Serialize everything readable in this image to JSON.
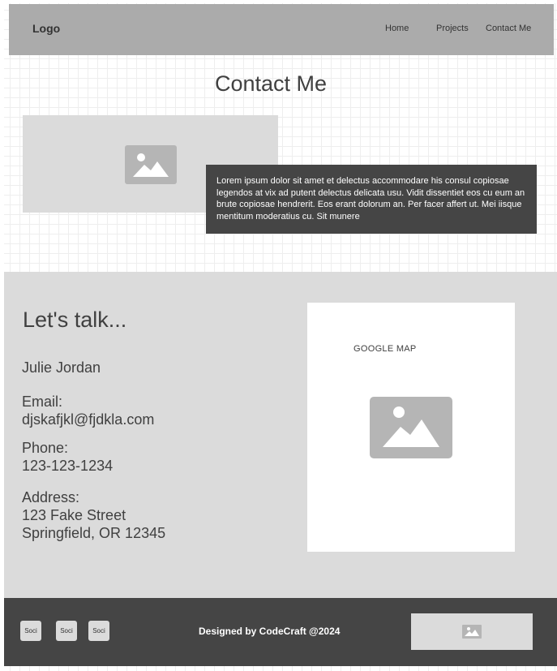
{
  "header": {
    "logo": "Logo",
    "nav": [
      "Home",
      "Projects",
      "Contact Me"
    ]
  },
  "hero": {
    "title": "Contact Me",
    "image_icon": "image-placeholder-icon",
    "body_text": "Lorem ipsum dolor sit amet et delectus accommodare his consul copiosae legendos at vix ad putent delectus delicata usu. Vidit dissentiet eos cu eum an brute copiosae hendrerit. Eos erant dolorum an. Per facer affert ut. Mei iisque mentitum moderatius cu. Sit munere"
  },
  "contact": {
    "heading": "Let's talk...",
    "name": "Julie Jordan",
    "email_label": "Email:",
    "email": "djskafjkl@fjdkla.com",
    "phone_label": "Phone:",
    "phone": "123-123-1234",
    "address_label": "Address:",
    "address_line1": "123 Fake Street",
    "address_line2": "Springfield, OR 12345",
    "map_label": "GOOGLE MAP"
  },
  "footer": {
    "socials": [
      "Soci",
      "Soci",
      "Soci"
    ],
    "credit": "Designed by CodeCraft @2024"
  },
  "colors": {
    "header_bg": "#ababab",
    "section_bg": "#dbdbdb",
    "dark_bg": "#454545",
    "placeholder_icon": "#b5b5b5"
  }
}
